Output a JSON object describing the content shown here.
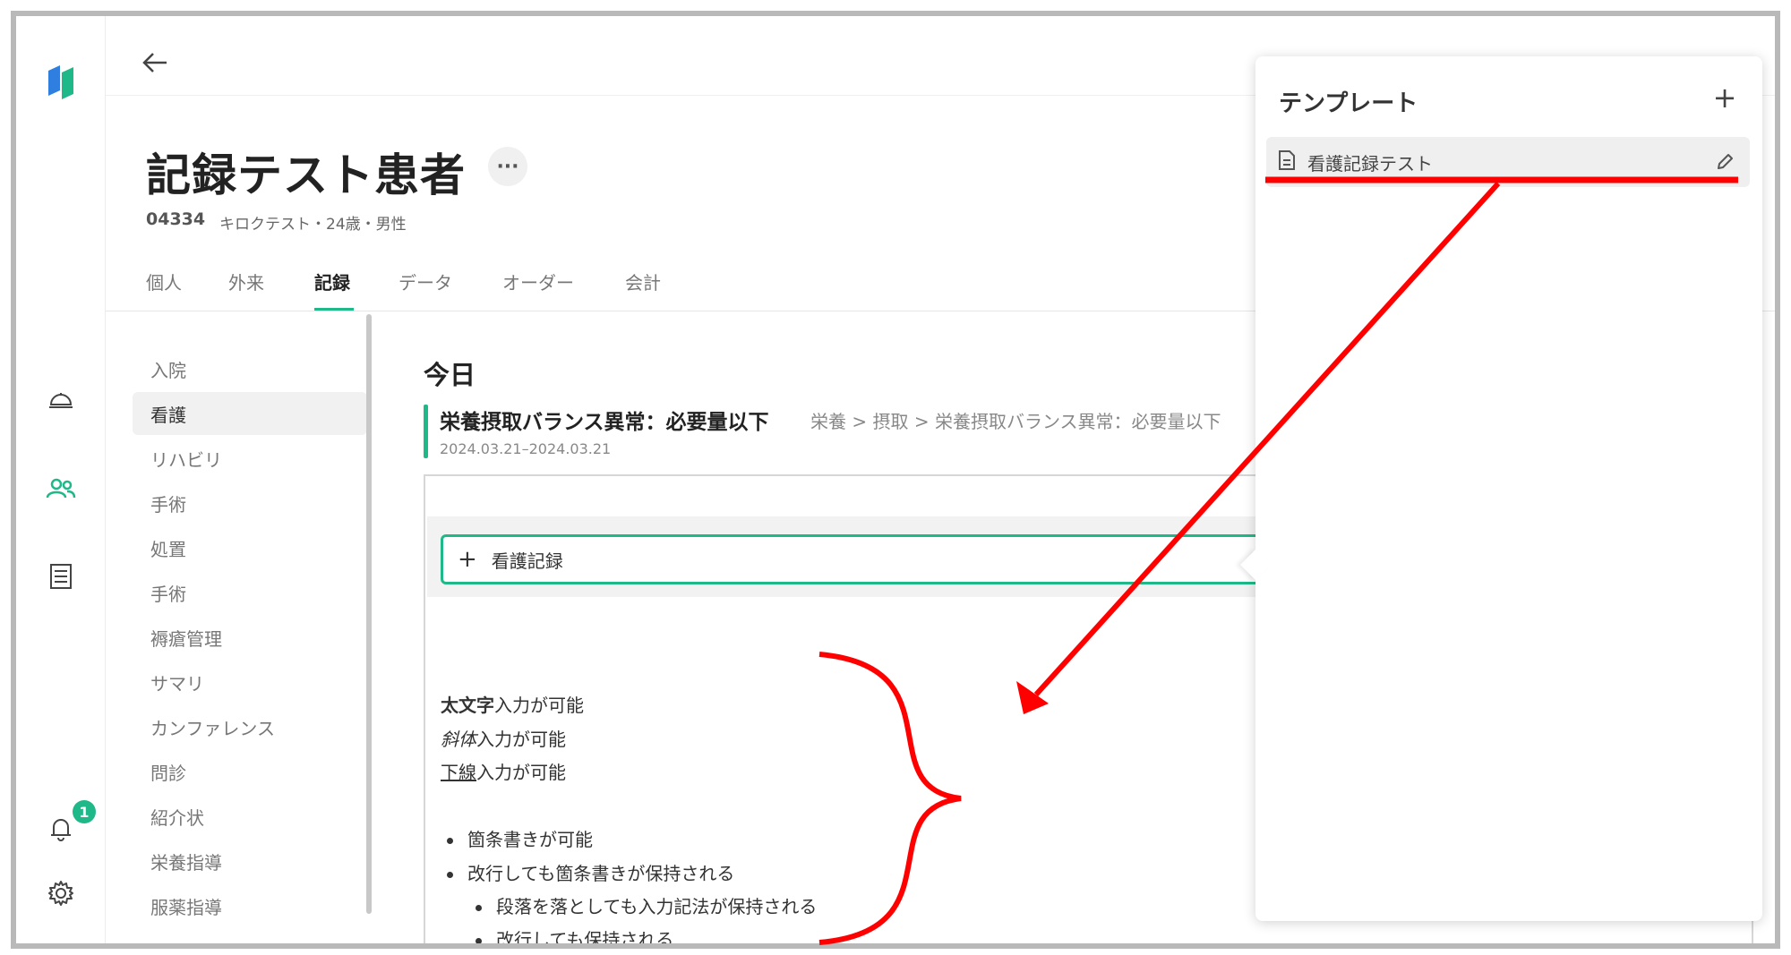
{
  "header": {
    "patient_name": "記録テスト患者",
    "more_label": "···",
    "patient_id": "04334",
    "patient_info": "キロクテスト・24歳・男性"
  },
  "tabs": [
    {
      "label": "個人"
    },
    {
      "label": "外来"
    },
    {
      "label": "記録",
      "active": true
    },
    {
      "label": "データ"
    },
    {
      "label": "オーダー"
    },
    {
      "label": "会計"
    }
  ],
  "subnav": [
    {
      "label": "入院"
    },
    {
      "label": "看護",
      "active": true
    },
    {
      "label": "リハビリ"
    },
    {
      "label": "手術"
    },
    {
      "label": "処置"
    },
    {
      "label": "手術"
    },
    {
      "label": "褥瘡管理"
    },
    {
      "label": "サマリ"
    },
    {
      "label": "カンファレンス"
    },
    {
      "label": "問診"
    },
    {
      "label": "紹介状"
    },
    {
      "label": "栄養指導"
    },
    {
      "label": "服薬指導"
    }
  ],
  "rail": {
    "notification_count": "1",
    "icons": [
      "logo-icon",
      "bell-service-icon",
      "users-icon",
      "list-icon",
      "notification-bell-icon",
      "gear-icon"
    ]
  },
  "content": {
    "section_title": "今日",
    "item_title": "栄養摂取バランス異常：必要量以下",
    "item_path": "栄養 > 摂取 > 栄養摂取バランス異常：必要量以下",
    "item_date": "2024.03.21–2024.03.21",
    "add_record_label": "看護記録",
    "lines": {
      "bold_word": "太文字",
      "bold_rest": "入力が可能",
      "italic_word": "斜体",
      "italic_rest": "入力が可能",
      "underline_word": "下線",
      "underline_rest": "入力が可能"
    },
    "bullets": [
      {
        "text": "箇条書きが可能",
        "level": 1
      },
      {
        "text": "改行しても箇条書きが保持される",
        "level": 1
      },
      {
        "text": "段落を落としても入力記法が保持される",
        "level": 2
      },
      {
        "text": "改行しても保持される",
        "level": 2
      }
    ]
  },
  "template_panel": {
    "title": "テンプレート",
    "add_label": "+",
    "items": [
      {
        "label": "看護記録テスト"
      }
    ]
  },
  "colors": {
    "accent": "#1fb889",
    "annotation": "#ff0000"
  }
}
